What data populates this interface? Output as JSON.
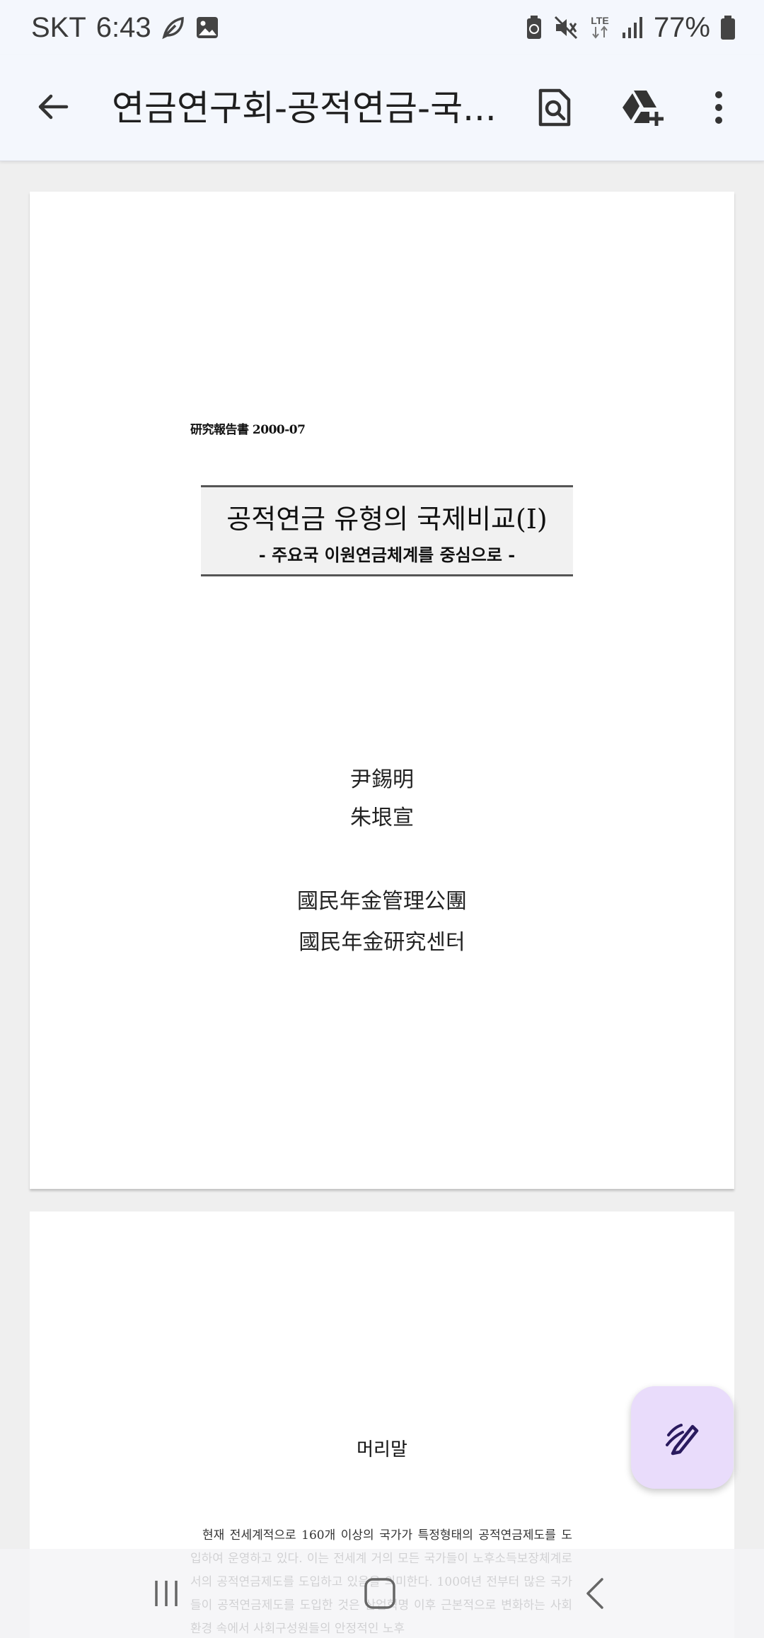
{
  "status_bar": {
    "carrier": "SKT",
    "time": "6:43",
    "network": "LTE",
    "battery": "77%",
    "icons": [
      "leaf-icon",
      "image-icon",
      "battery-saver-icon",
      "mute-icon",
      "lte-icon",
      "signal-icon",
      "battery-icon"
    ]
  },
  "app_bar": {
    "title": "연금연구회-공적연금-국...",
    "icons": [
      "back-arrow-icon",
      "search-document-icon",
      "drive-add-icon",
      "more-vert-icon"
    ]
  },
  "page1": {
    "report_no": "研究報告書  2000-07",
    "title": "공적연금 유형의 국제비교(Ⅰ)",
    "subtitle": "- 주요국 이원연금체계를 중심으로 -",
    "authors": [
      "尹錫明",
      "朱垠宣"
    ],
    "orgs": [
      "國民年金管理公團",
      "國民年金研究센터"
    ]
  },
  "page2": {
    "heading": "머리말",
    "paragraph": "현재 전세계적으로 160개 이상의 국가가 특정형태의 공적연금제도를 도입하여 운영하고 있다. 이는 전세계 거의 모든 국가들이 노후소득보장체계로서의 공적연금제도를 도입하고 있음을 의미한다. 100여년 전부터 많은 국가들이 공적연금제도를 도입한 것은 산업혁명 이후 근본적으로 변화하는 사회환경 속에서 사회구성원들의 안정적인 노후"
  },
  "fab": {
    "icon": "edit-pen-icon"
  },
  "nav_bar": {
    "icons": [
      "recent-apps-icon",
      "home-icon",
      "back-nav-icon"
    ]
  },
  "colors": {
    "bar_bg": "#f4f7fd",
    "fab_bg": "#e9dcfb",
    "fab_icon": "#2a1a5e",
    "page_bg": "#efefef"
  }
}
